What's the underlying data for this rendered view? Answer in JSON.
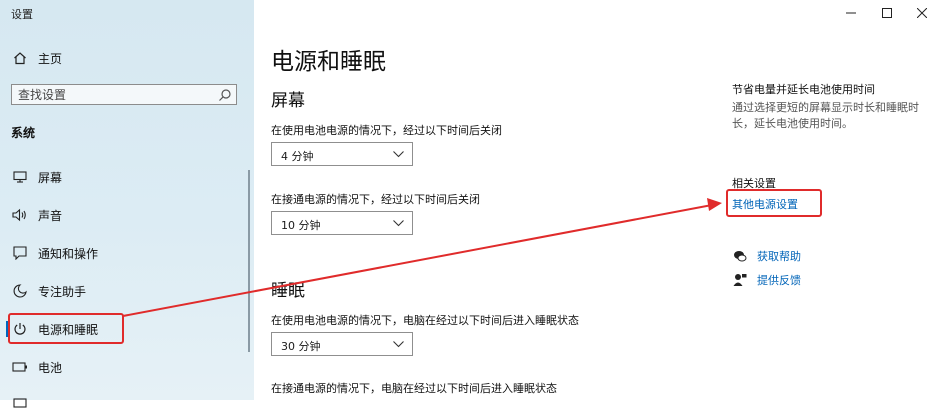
{
  "window": {
    "title": "设置"
  },
  "sidebar": {
    "home_label": "主页",
    "search_placeholder": "查找设置",
    "group_label": "系统",
    "items": [
      {
        "label": "屏幕",
        "icon": "monitor-icon"
      },
      {
        "label": "声音",
        "icon": "speaker-icon"
      },
      {
        "label": "通知和操作",
        "icon": "notification-icon"
      },
      {
        "label": "专注助手",
        "icon": "moon-icon"
      },
      {
        "label": "电源和睡眠",
        "icon": "power-icon",
        "selected": true
      },
      {
        "label": "电池",
        "icon": "battery-icon"
      }
    ]
  },
  "main": {
    "title": "电源和睡眠",
    "screen": {
      "title": "屏幕",
      "battery_label": "在使用电池电源的情况下，经过以下时间后关闭",
      "battery_value": "4 分钟",
      "plugged_label": "在接通电源的情况下，经过以下时间后关闭",
      "plugged_value": "10 分钟"
    },
    "sleep": {
      "title": "睡眠",
      "battery_label": "在使用电池电源的情况下，电脑在经过以下时间后进入睡眠状态",
      "battery_value": "30 分钟",
      "plugged_label": "在接通电源的情况下，电脑在经过以下时间后进入睡眠状态"
    }
  },
  "aside": {
    "tip_title": "节省电量并延长电池使用时间",
    "tip_desc": "通过选择更短的屏幕显示时长和睡眠时长，延长电池使用时间。",
    "related_title": "相关设置",
    "related_link": "其他电源设置",
    "help_label": "获取帮助",
    "feedback_label": "提供反馈"
  },
  "colors": {
    "accent": "#0067c0",
    "highlight": "#e02b2b",
    "link": "#0064b8"
  }
}
